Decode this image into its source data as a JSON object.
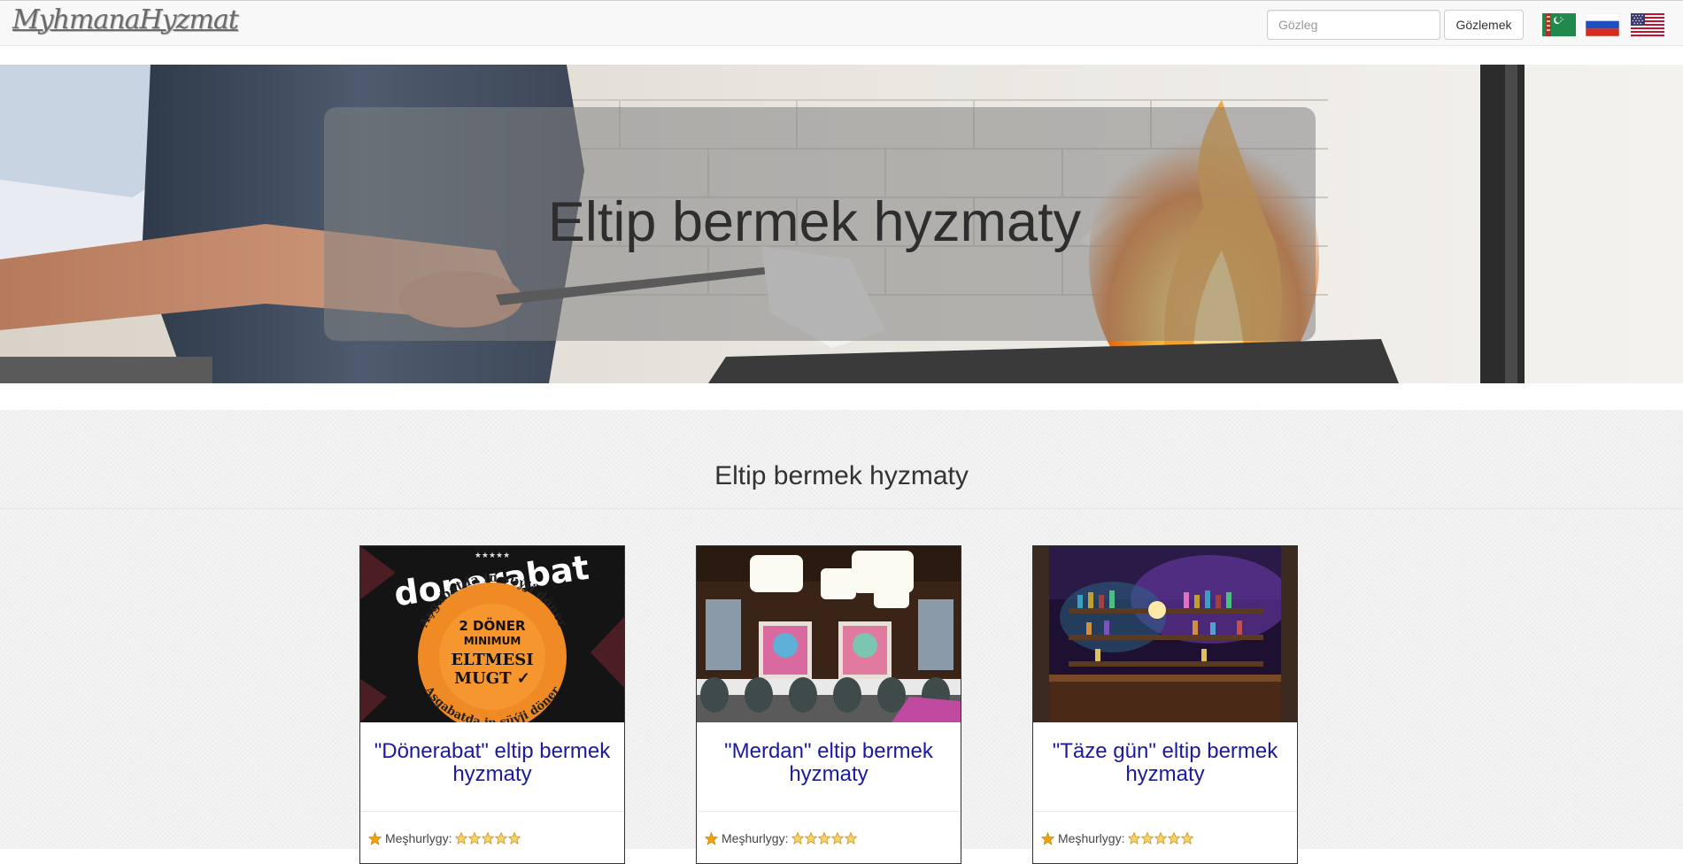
{
  "navbar": {
    "brand": "MyhmanaHyzmat",
    "search_placeholder": "Gözleg",
    "search_value": "",
    "search_button": "Gözlemek",
    "languages": [
      {
        "code": "tm",
        "icon": "turkmenistan-flag-icon"
      },
      {
        "code": "ru",
        "icon": "russia-flag-icon"
      },
      {
        "code": "en",
        "icon": "usa-flag-icon"
      }
    ]
  },
  "hero": {
    "title": "Eltip bermek hyzmaty"
  },
  "section": {
    "title": "Eltip bermek hyzmaty"
  },
  "cards": [
    {
      "title": "\"Dönerabat\" eltip bermek hyzmaty",
      "rating_label": "Meşhurlygy:",
      "stars": 5,
      "image": {
        "stars_text": "★★★★★",
        "logo": "donerabat",
        "arc_top": "Aşgabatda in süýji döner",
        "arc_bottom": "Aşgabatda in süýji döner",
        "line1": "2 DÖNER",
        "line2": "MINIMUM",
        "line3": "ELTMESI",
        "line4": "MUGT ✓"
      }
    },
    {
      "title": "\"Merdan\" eltip bermek hyzmaty",
      "rating_label": "Meşhurlygy:",
      "stars": 5
    },
    {
      "title": "\"Täze gün\" eltip bermek hyzmaty",
      "rating_label": "Meşhurlygy:",
      "stars": 5
    }
  ],
  "colors": {
    "navbar_bg": "#f8f8f8",
    "link": "#1a1aa0",
    "content_bg": "#f3f3f3",
    "star": "#f0a30a"
  }
}
